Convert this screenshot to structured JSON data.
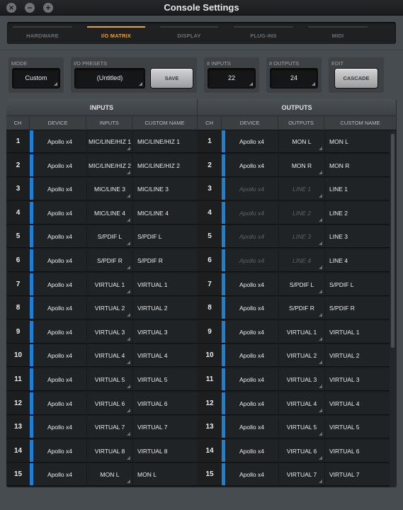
{
  "window": {
    "title": "Console Settings",
    "close_glyph": "×",
    "minimize_glyph": "−",
    "zoom_glyph": "+"
  },
  "tabs": [
    {
      "label": "HARDWARE",
      "active": false
    },
    {
      "label": "I/O MATRIX",
      "active": true
    },
    {
      "label": "DISPLAY",
      "active": false
    },
    {
      "label": "PLUG-INS",
      "active": false
    },
    {
      "label": "MIDI",
      "active": false
    }
  ],
  "controls": {
    "mode": {
      "label": "MODE",
      "value": "Custom"
    },
    "io_presets": {
      "label": "I/O PRESETS",
      "value": "(Untitled)",
      "save_label": "SAVE"
    },
    "inputs": {
      "label": "# INPUTS",
      "value": "22"
    },
    "outputs": {
      "label": "# OUTPUTS",
      "value": "24"
    },
    "edit": {
      "label": "EDIT",
      "button_label": "CASCADE"
    }
  },
  "colors": {
    "accent": "#e8a431",
    "channel_bar": "#1d7fd6"
  },
  "inputs_section": {
    "title": "INPUTS",
    "columns": [
      "CH",
      "DEVICE",
      "INPUTS",
      "CUSTOM NAME"
    ],
    "rows": [
      {
        "ch": "1",
        "device": "Apollo x4",
        "io": "MIC/LINE/HIZ 1",
        "name": "MIC/LINE/HIZ 1",
        "dim": false
      },
      {
        "ch": "2",
        "device": "Apollo x4",
        "io": "MIC/LINE/HIZ 2",
        "name": "MIC/LINE/HIZ 2",
        "dim": false
      },
      {
        "ch": "3",
        "device": "Apollo x4",
        "io": "MIC/LINE 3",
        "name": "MIC/LINE 3",
        "dim": false
      },
      {
        "ch": "4",
        "device": "Apollo x4",
        "io": "MIC/LINE 4",
        "name": "MIC/LINE 4",
        "dim": false
      },
      {
        "ch": "5",
        "device": "Apollo x4",
        "io": "S/PDIF L",
        "name": "S/PDIF L",
        "dim": false
      },
      {
        "ch": "6",
        "device": "Apollo x4",
        "io": "S/PDIF R",
        "name": "S/PDIF R",
        "dim": false
      },
      {
        "ch": "7",
        "device": "Apollo x4",
        "io": "VIRTUAL 1",
        "name": "VIRTUAL 1",
        "dim": false
      },
      {
        "ch": "8",
        "device": "Apollo x4",
        "io": "VIRTUAL 2",
        "name": "VIRTUAL 2",
        "dim": false
      },
      {
        "ch": "9",
        "device": "Apollo x4",
        "io": "VIRTUAL 3",
        "name": "VIRTUAL 3",
        "dim": false
      },
      {
        "ch": "10",
        "device": "Apollo x4",
        "io": "VIRTUAL 4",
        "name": "VIRTUAL 4",
        "dim": false
      },
      {
        "ch": "11",
        "device": "Apollo x4",
        "io": "VIRTUAL 5",
        "name": "VIRTUAL 5",
        "dim": false
      },
      {
        "ch": "12",
        "device": "Apollo x4",
        "io": "VIRTUAL 6",
        "name": "VIRTUAL 6",
        "dim": false
      },
      {
        "ch": "13",
        "device": "Apollo x4",
        "io": "VIRTUAL 7",
        "name": "VIRTUAL 7",
        "dim": false
      },
      {
        "ch": "14",
        "device": "Apollo x4",
        "io": "VIRTUAL 8",
        "name": "VIRTUAL 8",
        "dim": false
      },
      {
        "ch": "15",
        "device": "Apollo x4",
        "io": "MON L",
        "name": "MON L",
        "dim": false
      }
    ]
  },
  "outputs_section": {
    "title": "OUTPUTS",
    "columns": [
      "CH",
      "DEVICE",
      "OUTPUTS",
      "CUSTOM NAME"
    ],
    "rows": [
      {
        "ch": "1",
        "device": "Apollo x4",
        "io": "MON L",
        "name": "MON L",
        "dim": false
      },
      {
        "ch": "2",
        "device": "Apollo x4",
        "io": "MON R",
        "name": "MON R",
        "dim": false
      },
      {
        "ch": "3",
        "device": "Apollo x4",
        "io": "LINE 1",
        "name": "LINE 1",
        "dim": true
      },
      {
        "ch": "4",
        "device": "Apollo x4",
        "io": "LINE 2",
        "name": "LINE 2",
        "dim": true
      },
      {
        "ch": "5",
        "device": "Apollo x4",
        "io": "LINE 3",
        "name": "LINE 3",
        "dim": true
      },
      {
        "ch": "6",
        "device": "Apollo x4",
        "io": "LINE 4",
        "name": "LINE 4",
        "dim": true
      },
      {
        "ch": "7",
        "device": "Apollo x4",
        "io": "S/PDIF L",
        "name": "S/PDIF L",
        "dim": false
      },
      {
        "ch": "8",
        "device": "Apollo x4",
        "io": "S/PDIF R",
        "name": "S/PDIF R",
        "dim": false
      },
      {
        "ch": "9",
        "device": "Apollo x4",
        "io": "VIRTUAL 1",
        "name": "VIRTUAL 1",
        "dim": false
      },
      {
        "ch": "10",
        "device": "Apollo x4",
        "io": "VIRTUAL 2",
        "name": "VIRTUAL 2",
        "dim": false
      },
      {
        "ch": "11",
        "device": "Apollo x4",
        "io": "VIRTUAL 3",
        "name": "VIRTUAL 3",
        "dim": false
      },
      {
        "ch": "12",
        "device": "Apollo x4",
        "io": "VIRTUAL 4",
        "name": "VIRTUAL 4",
        "dim": false
      },
      {
        "ch": "13",
        "device": "Apollo x4",
        "io": "VIRTUAL 5",
        "name": "VIRTUAL 5",
        "dim": false
      },
      {
        "ch": "14",
        "device": "Apollo x4",
        "io": "VIRTUAL 6",
        "name": "VIRTUAL 6",
        "dim": false
      },
      {
        "ch": "15",
        "device": "Apollo x4",
        "io": "VIRTUAL 7",
        "name": "VIRTUAL 7",
        "dim": false
      }
    ]
  }
}
